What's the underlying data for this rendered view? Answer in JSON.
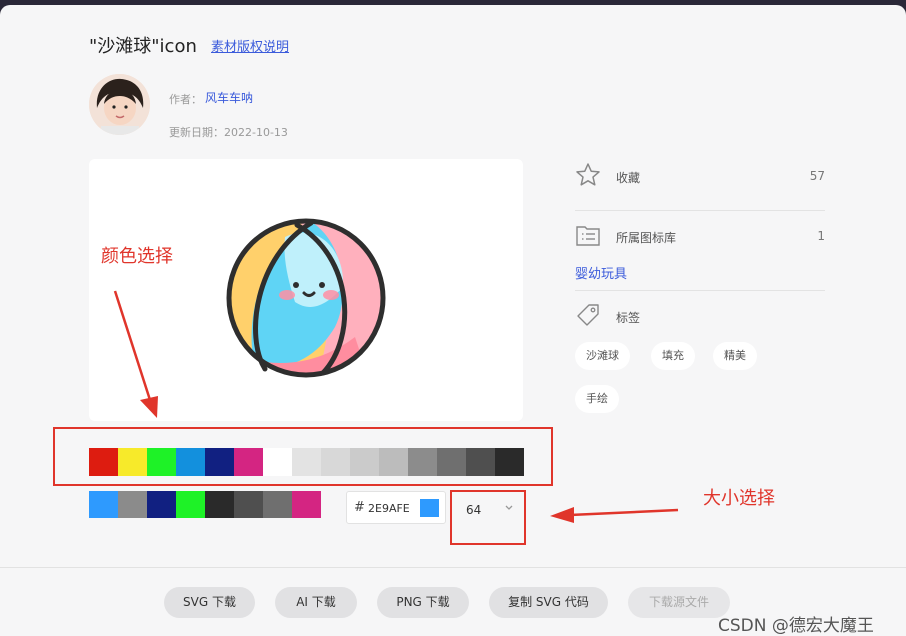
{
  "header": {
    "title": "\"沙滩球\"icon",
    "copyright_link": "素材版权说明"
  },
  "author": {
    "label": "作者：",
    "name": "风车车呐",
    "date_label": "更新日期：",
    "date": "2022-10-13"
  },
  "annotations": {
    "color_select": "颜色选择",
    "size_select": "大小选择"
  },
  "palette": {
    "row1": [
      "#dd1c10",
      "#f7ea2a",
      "#1ef227",
      "#1390dd",
      "#112081",
      "#d42582",
      "#ffffff",
      "#e3e3e3",
      "#d8d8d8",
      "#cbcbcb",
      "#bcbcbc",
      "#8c8c8c",
      "#6f6f6f",
      "#4f4f4f",
      "#2a2a2a"
    ],
    "row2": [
      "#2e9afe",
      "#8b8b8b",
      "#112081",
      "#1ef227",
      "#2a2a2a",
      "#4f4f4f",
      "#6f6f6f",
      "#d42582"
    ]
  },
  "color_input": {
    "hash": "#",
    "value": "2E9AFE",
    "swatch": "#2e9afe"
  },
  "size_select": {
    "value": "64"
  },
  "sidebar": {
    "favorite": {
      "label": "收藏",
      "count": "57"
    },
    "library": {
      "label": "所属图标库",
      "count": "1",
      "link": "婴幼玩具"
    },
    "tags": {
      "label": "标签",
      "items": [
        "沙滩球",
        "填充",
        "精美",
        "手绘"
      ]
    }
  },
  "footer": {
    "buttons": [
      "SVG 下载",
      "AI 下载",
      "PNG 下载",
      "复制 SVG 代码",
      "下载源文件"
    ]
  },
  "watermark": "CSDN @德宏大魔王",
  "colors": {
    "accent_link": "#3b5bdb",
    "annotation_red": "#e0352b"
  }
}
